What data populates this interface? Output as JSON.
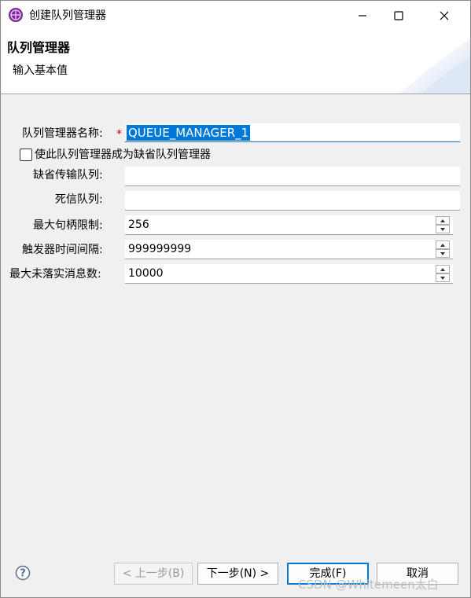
{
  "window": {
    "title": "创建队列管理器",
    "icon": "globe-network-icon"
  },
  "banner": {
    "title": "队列管理器",
    "description": "输入基本值"
  },
  "form": {
    "queue_manager_name": {
      "label": "队列管理器名称:",
      "required_marker": "*",
      "value": "QUEUE_MANAGER_1",
      "selected": true
    },
    "default_checkbox": {
      "label": "使此队列管理器成为缺省队列管理器",
      "checked": false
    },
    "default_transmission_queue": {
      "label": "缺省传输队列:",
      "value": ""
    },
    "dead_letter_queue": {
      "label": "死信队列:",
      "value": ""
    },
    "max_handle_limit": {
      "label": "最大句柄限制:",
      "value": "256"
    },
    "trigger_interval": {
      "label": "触发器时间间隔:",
      "value": "999999999"
    },
    "max_uncommitted_messages": {
      "label": "最大未落实消息数:",
      "value": "10000"
    }
  },
  "buttons": {
    "back": "< 上一步(B)",
    "next": "下一步(N) >",
    "finish": "完成(F)",
    "cancel": "取消"
  },
  "watermark": "CSDN @Whitemeen太白",
  "colors": {
    "accent": "#0078d7",
    "required": "#c00000",
    "background": "#f0f0f0"
  }
}
